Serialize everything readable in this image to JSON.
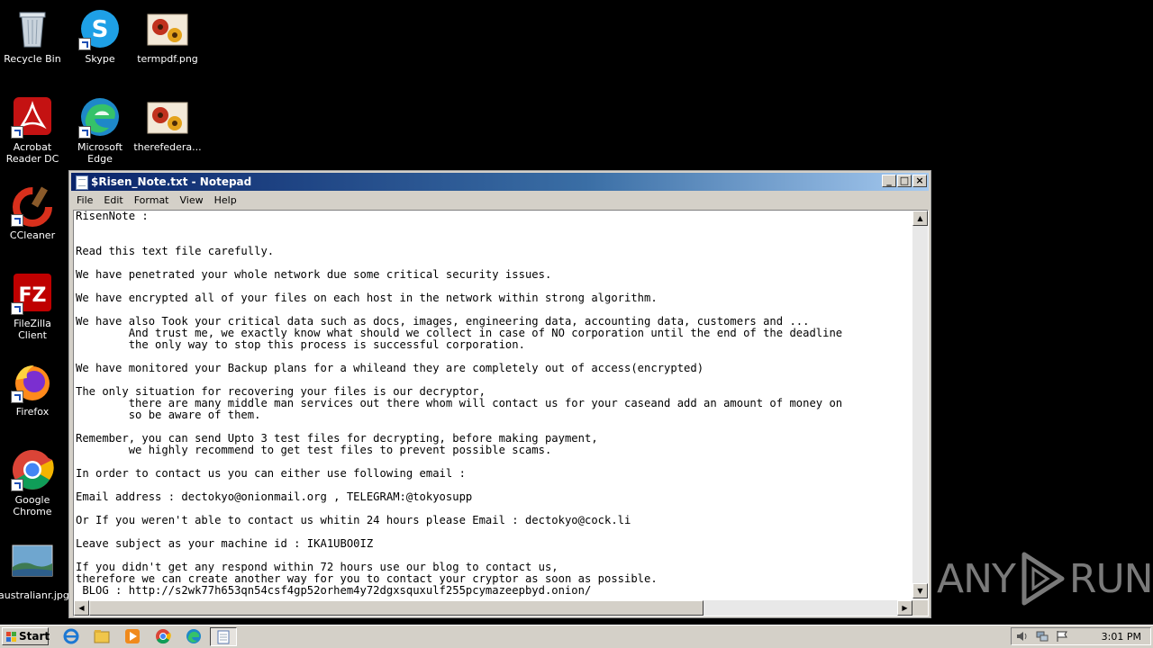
{
  "desktop": {
    "icons": [
      {
        "label": "Recycle Bin",
        "icon": "recycle-bin-icon"
      },
      {
        "label": "Skype",
        "icon": "skype-icon"
      },
      {
        "label": "termpdf.png",
        "icon": "image-file-icon"
      },
      {
        "label": "Acrobat Reader DC",
        "icon": "acrobat-icon"
      },
      {
        "label": "Microsoft Edge",
        "icon": "edge-icon"
      },
      {
        "label": "therefedera...",
        "icon": "image-file-icon"
      },
      {
        "label": "CCleaner",
        "icon": "ccleaner-icon"
      },
      {
        "label": "FileZilla Client",
        "icon": "filezilla-icon"
      },
      {
        "label": "Firefox",
        "icon": "firefox-icon"
      },
      {
        "label": "Google Chrome",
        "icon": "chrome-icon"
      },
      {
        "label": "australianr.jpg",
        "icon": "image-file-icon"
      }
    ]
  },
  "window": {
    "title": "$Risen_Note.txt - Notepad",
    "menu": [
      "File",
      "Edit",
      "Format",
      "View",
      "Help"
    ],
    "lines": [
      "RisenNote :",
      "",
      "",
      "Read this text file carefully.",
      "",
      "We have penetrated your whole network due some critical security issues.",
      "",
      "We have encrypted all of your files on each host in the network within strong algorithm.",
      "",
      "We have also Took your critical data such as docs, images, engineering data, accounting data, customers and ...",
      "        And trust me, we exactly know what should we collect in case of NO corporation until the end of the deadline",
      "        the only way to stop this process is successful corporation.",
      "",
      "We have monitored your Backup plans for a whileand they are completely out of access(encrypted)",
      "",
      "The only situation for recovering your files is our decryptor,",
      "        there are many middle man services out there whom will contact us for your caseand add an amount of money on",
      "        so be aware of them.",
      "",
      "Remember, you can send Upto 3 test files for decrypting, before making payment,",
      "        we highly recommend to get test files to prevent possible scams.",
      "",
      "In order to contact us you can either use following email :",
      "",
      "Email address : dectokyo@onionmail.org , TELEGRAM:@tokyosupp",
      "",
      "Or If you weren't able to contact us whitin 24 hours please Email : dectokyo@cock.li",
      "",
      "Leave subject as your machine id : IKA1UBO0IZ",
      "",
      "If you didn't get any respond within 72 hours use our blog to contact us,",
      "therefore we can create another way for you to contact your cryptor as soon as possible.",
      " BLOG : http://s2wk77h653qn54csf4gp52orhem4y72dgxsquxulf255pcymazeepbyd.onion/"
    ]
  },
  "watermark": {
    "text_left": "ANY",
    "text_right": "RUN"
  },
  "taskbar": {
    "start_label": "Start",
    "pinned": [
      "ie-icon",
      "explorer-icon",
      "media-player-icon",
      "chrome-icon",
      "edge-icon",
      "notepad-icon"
    ],
    "clock": "3:01 PM"
  },
  "colors": {
    "desktop": "#000000",
    "titlebar_start": "#0a246a",
    "titlebar_end": "#a6caf0",
    "taskbar": "#d4d0c8"
  }
}
